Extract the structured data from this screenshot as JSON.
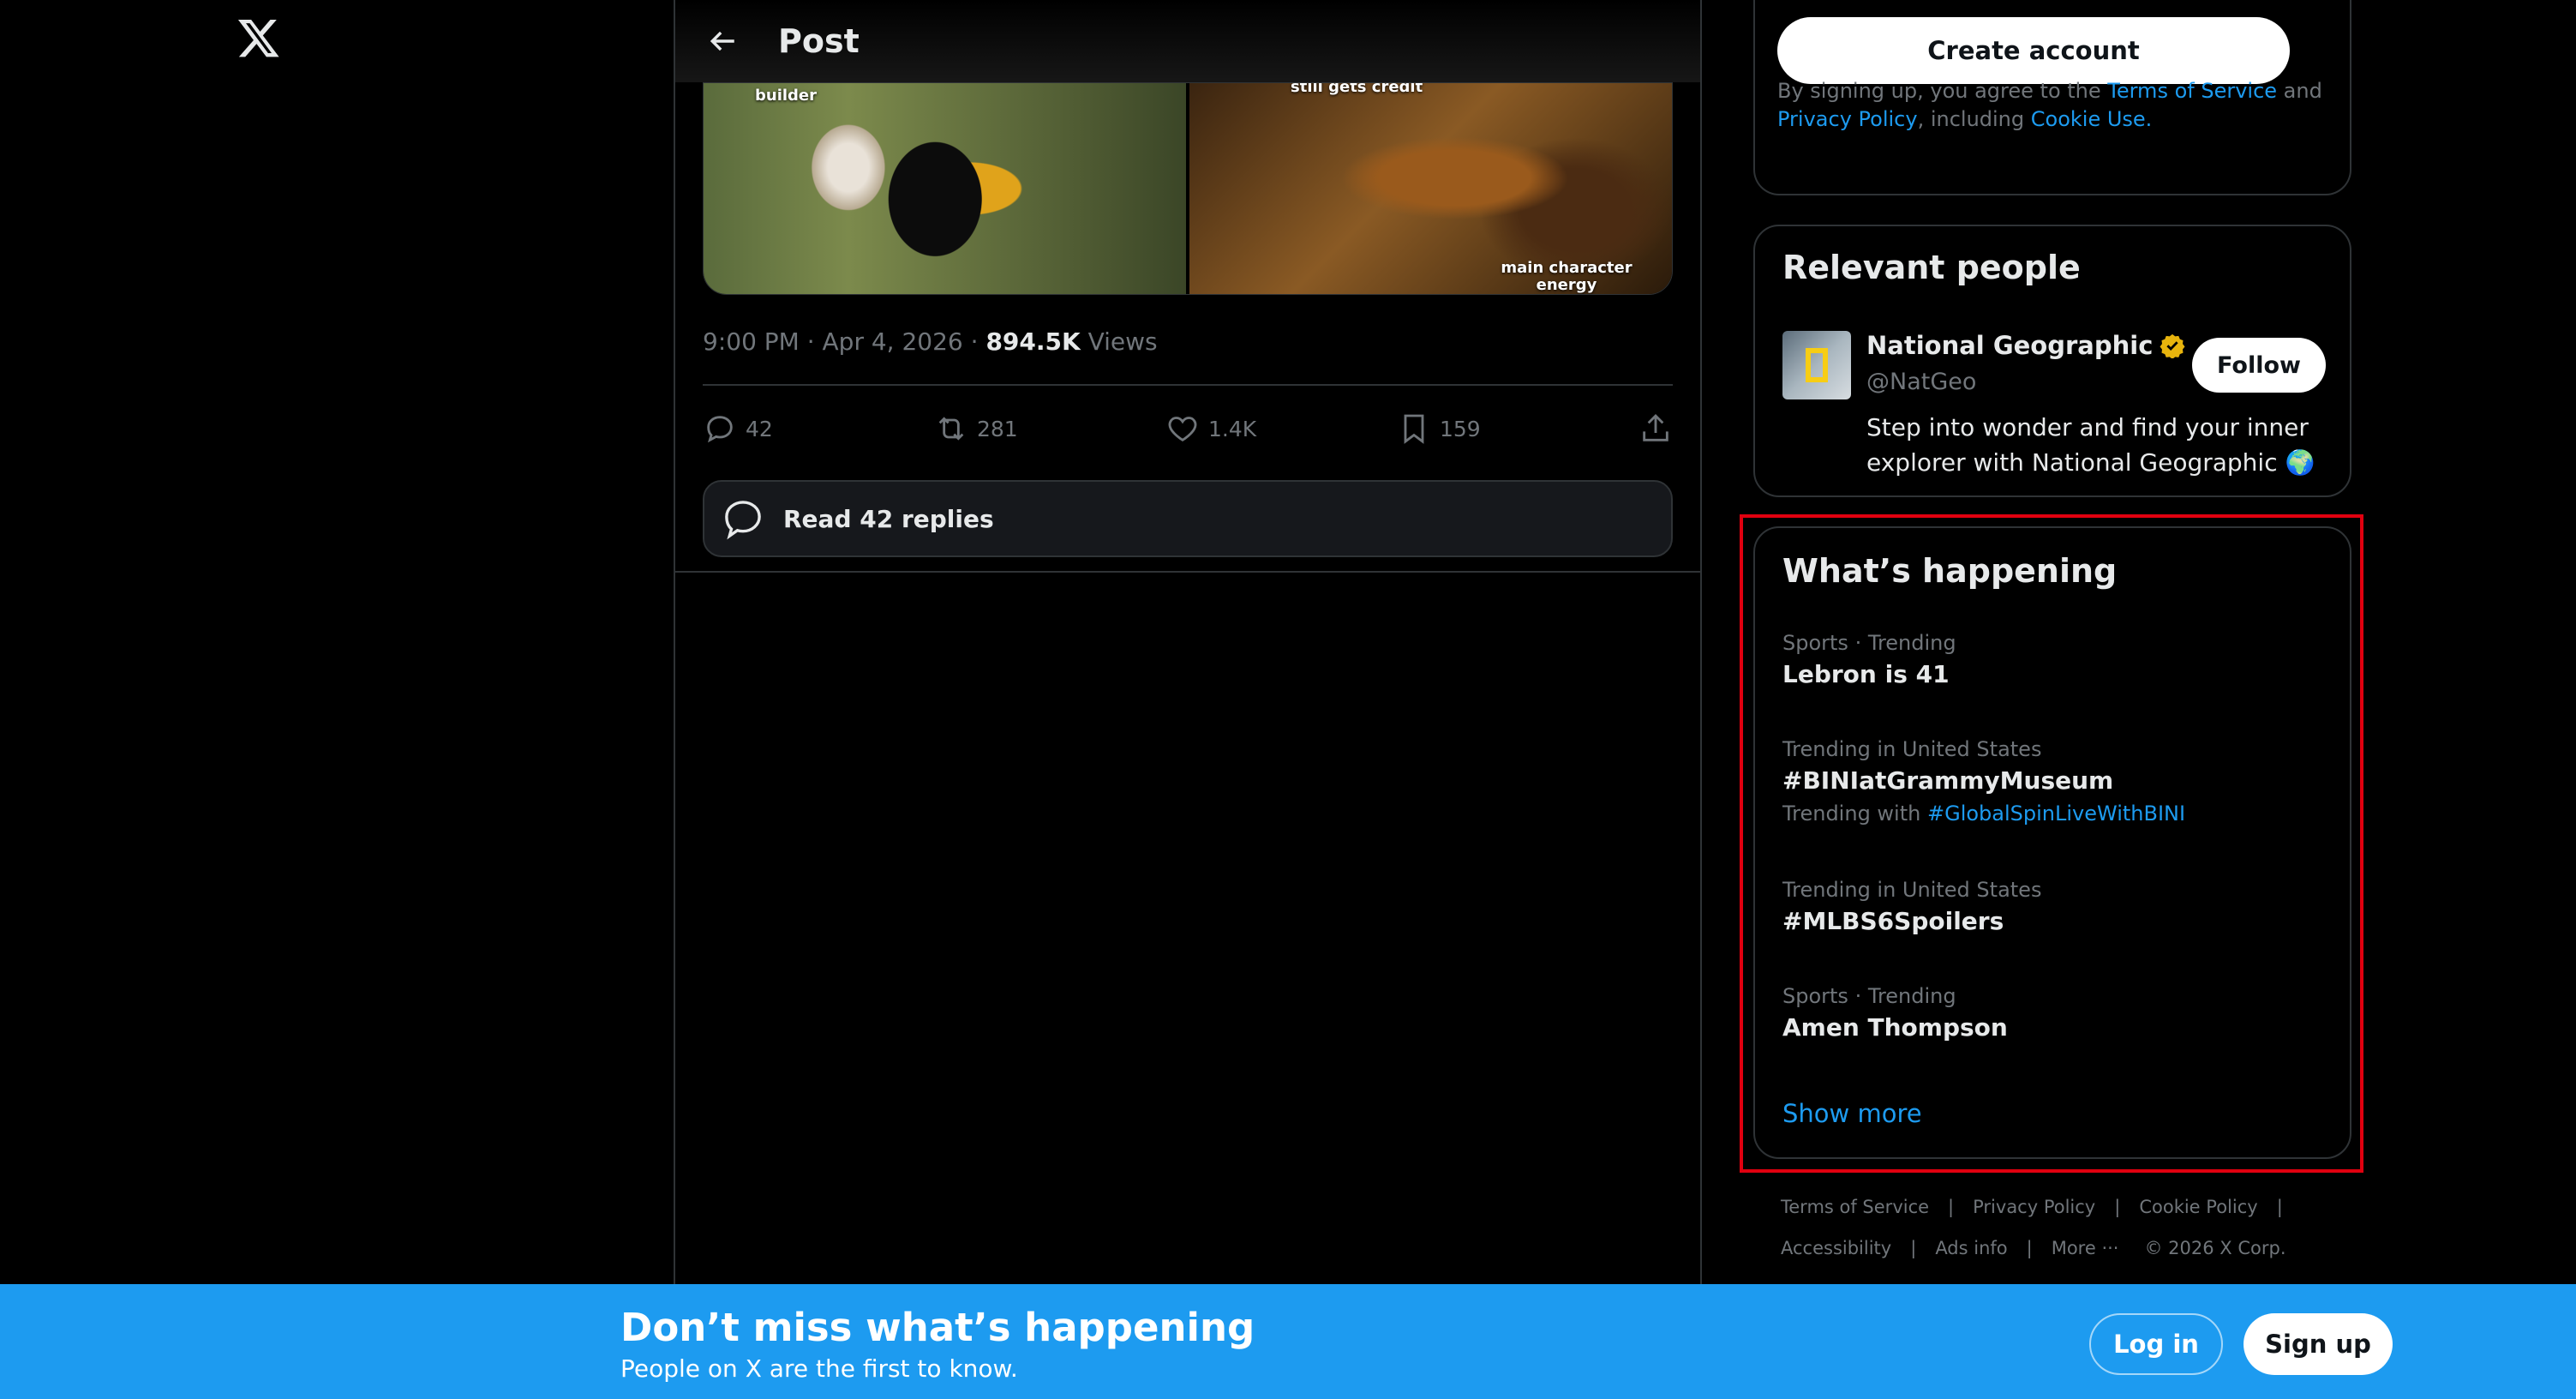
{
  "nav": {
    "logo_icon": "x-logo-icon"
  },
  "header": {
    "title": "Post",
    "back_icon": "arrow-left-icon"
  },
  "post": {
    "media": {
      "left_caption": "builder",
      "right_caption_top": "still gets credit",
      "right_caption_bottom": "main character energy"
    },
    "time": "9:00 PM · Apr 4, 2026 · ",
    "views_count": "894.5K",
    "views_label": " Views",
    "actions": {
      "replies": "42",
      "reposts": "281",
      "likes": "1.4K",
      "bookmarks": "159"
    },
    "read_replies": "Read 42 replies"
  },
  "signup_card": {
    "create_account": "Create account",
    "legal_prefix": "By signing up, you agree to the ",
    "terms": "Terms of Service",
    "and": " and",
    "privacy": "Privacy Policy",
    "including": ", including ",
    "cookie": "Cookie Use."
  },
  "relevant_people": {
    "title": "Relevant people",
    "name": "National Geographic",
    "handle": "@NatGeo",
    "follow": "Follow",
    "bio_line1": "Step into wonder and find your inner",
    "bio_line2": "explorer with National Geographic 🌍"
  },
  "whats_happening": {
    "title": "What’s happening",
    "trends": [
      {
        "context": "Sports · Trending",
        "name": "Lebron is 41"
      },
      {
        "context": "Trending in United States",
        "name": "#BINIatGrammyMuseum",
        "with_label": "Trending with ",
        "with_tag": "#GlobalSpinLiveWithBINI"
      },
      {
        "context": "Trending in United States",
        "name": "#MLBS6Spoilers"
      },
      {
        "context": "Sports · Trending",
        "name": "Amen Thompson"
      }
    ],
    "show_more": "Show more"
  },
  "footer": {
    "links_row1": [
      "Terms of Service",
      "Privacy Policy",
      "Cookie Policy"
    ],
    "links_row2": [
      "Accessibility",
      "Ads info",
      "More ···"
    ],
    "copyright": "© 2026 X Corp."
  },
  "banner": {
    "title": "Don’t miss what’s happening",
    "subtitle": "People on X are the first to know.",
    "login": "Log in",
    "signup": "Sign up"
  },
  "colors": {
    "accent": "#1d9bf0",
    "highlight": "#e0000f",
    "verified": "#e8b40d"
  }
}
